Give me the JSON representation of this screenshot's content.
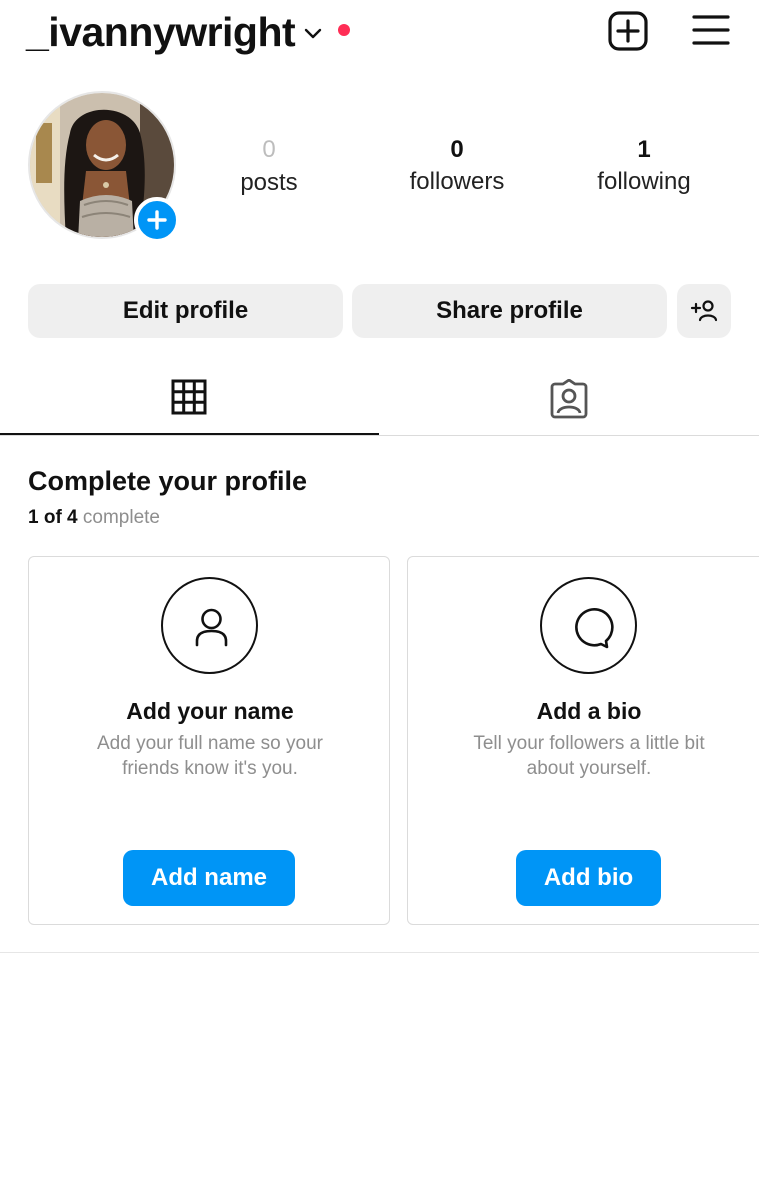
{
  "header": {
    "username": "_ivannywright",
    "icons": {
      "account_switcher": "chevron-down-icon",
      "notification": "red-dot",
      "new_post": "plus-square-icon",
      "menu": "hamburger-menu-icon"
    }
  },
  "profile": {
    "avatar": "profile-photo",
    "stats": [
      {
        "value": "0",
        "label": "posts"
      },
      {
        "value": "0",
        "label": "followers"
      },
      {
        "value": "1",
        "label": "following"
      }
    ]
  },
  "actions": {
    "edit_label": "Edit profile",
    "share_label": "Share profile",
    "suggest_icon": "add-person-icon"
  },
  "tabs": [
    {
      "icon": "grid-icon",
      "selected": true
    },
    {
      "icon": "tagged-person-icon",
      "selected": false
    }
  ],
  "complete_profile": {
    "title": "Complete your profile",
    "progress_count": "1 of 4",
    "progress_suffix": "complete",
    "cards": [
      {
        "icon": "person-icon",
        "title": "Add your name",
        "description": "Add your full name so your friends know it's you.",
        "button": "Add name"
      },
      {
        "icon": "speech-bubble-icon",
        "title": "Add a bio",
        "description": "Tell your followers a little bit about yourself.",
        "button": "Add bio"
      }
    ]
  },
  "colors": {
    "accent": "#0095f6",
    "notification_dot": "#ff2d55",
    "button_gray": "#efefef",
    "muted_text": "#8e8e8e"
  }
}
